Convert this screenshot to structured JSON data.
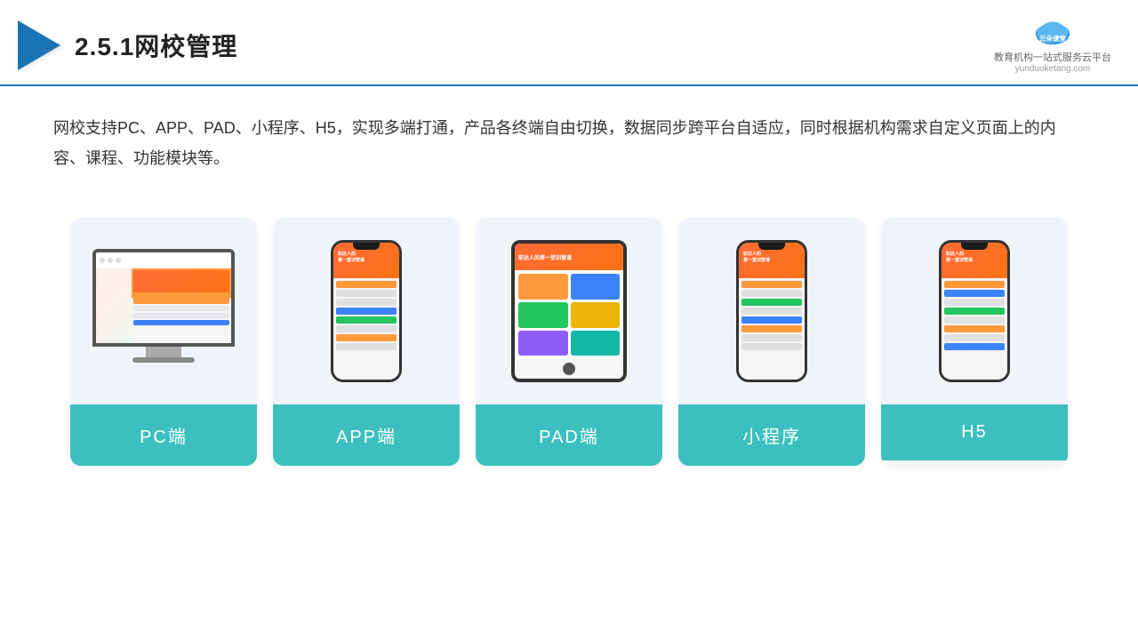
{
  "header": {
    "title": "2.5.1网校管理",
    "brand": {
      "name": "云朵课堂",
      "url": "yunduoketang.com",
      "tagline": "教育机构一站式服务云平台"
    }
  },
  "description": {
    "text": "网校支持PC、APP、PAD、小程序、H5，实现多端打通，产品各终端自由切换，数据同步跨平台自适应，同时根据机构需求自定义页面上的内容、课程、功能模块等。"
  },
  "cards": [
    {
      "id": "pc",
      "label": "PC端",
      "type": "pc"
    },
    {
      "id": "app",
      "label": "APP端",
      "type": "phone"
    },
    {
      "id": "pad",
      "label": "PAD端",
      "type": "pad"
    },
    {
      "id": "miniprogram",
      "label": "小程序",
      "type": "phone"
    },
    {
      "id": "h5",
      "label": "H5",
      "type": "phone"
    }
  ],
  "colors": {
    "primary_blue": "#1a73b5",
    "teal": "#3dbfbf",
    "accent_orange": "#f97316"
  }
}
